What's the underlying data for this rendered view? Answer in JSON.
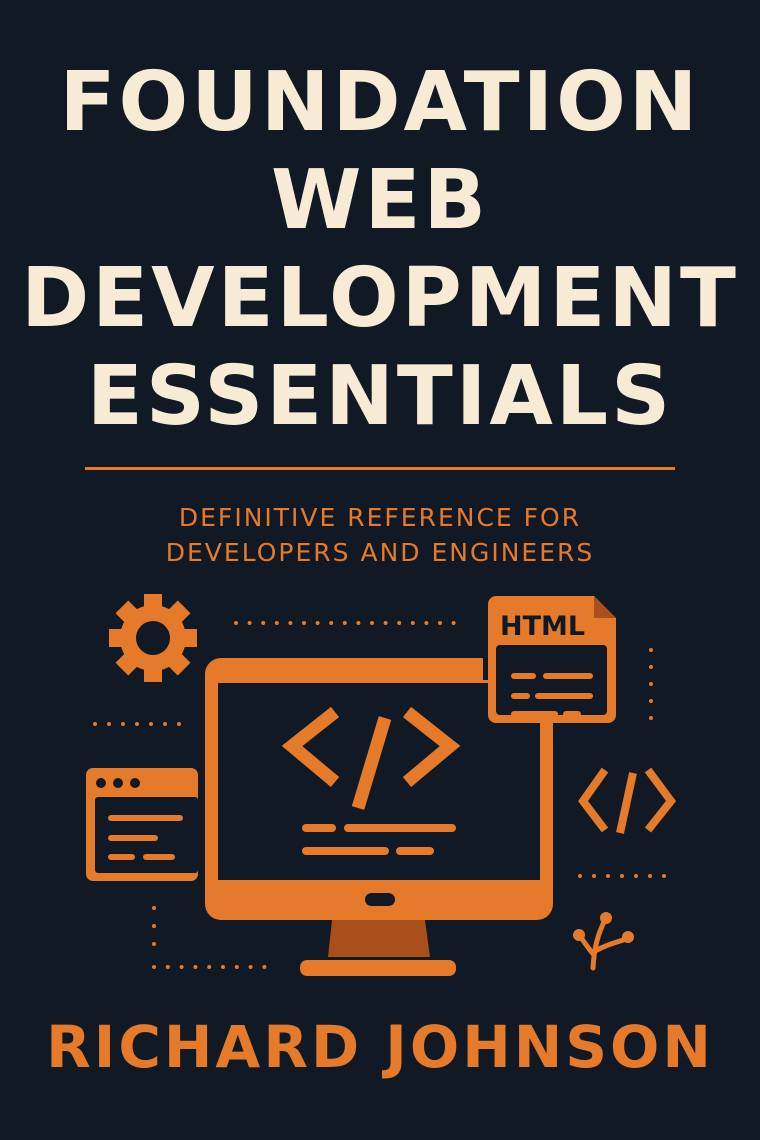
{
  "cover": {
    "title_lines": [
      "FOUNDATION",
      "WEB",
      "DEVELOPMENT",
      "ESSENTIALS"
    ],
    "subtitle_lines": [
      "DEFINITIVE REFERENCE FOR",
      "DEVELOPERS AND ENGINEERS"
    ],
    "author": "RICHARD JOHNSON",
    "html_badge": "HTML"
  },
  "colors": {
    "background": "#111a24",
    "accent": "#e57a2a",
    "title": "#f8ebd6"
  },
  "icons": [
    "gear-icon",
    "html-file-icon",
    "monitor-icon",
    "code-tag-icon",
    "browser-window-icon",
    "branch-icon"
  ]
}
